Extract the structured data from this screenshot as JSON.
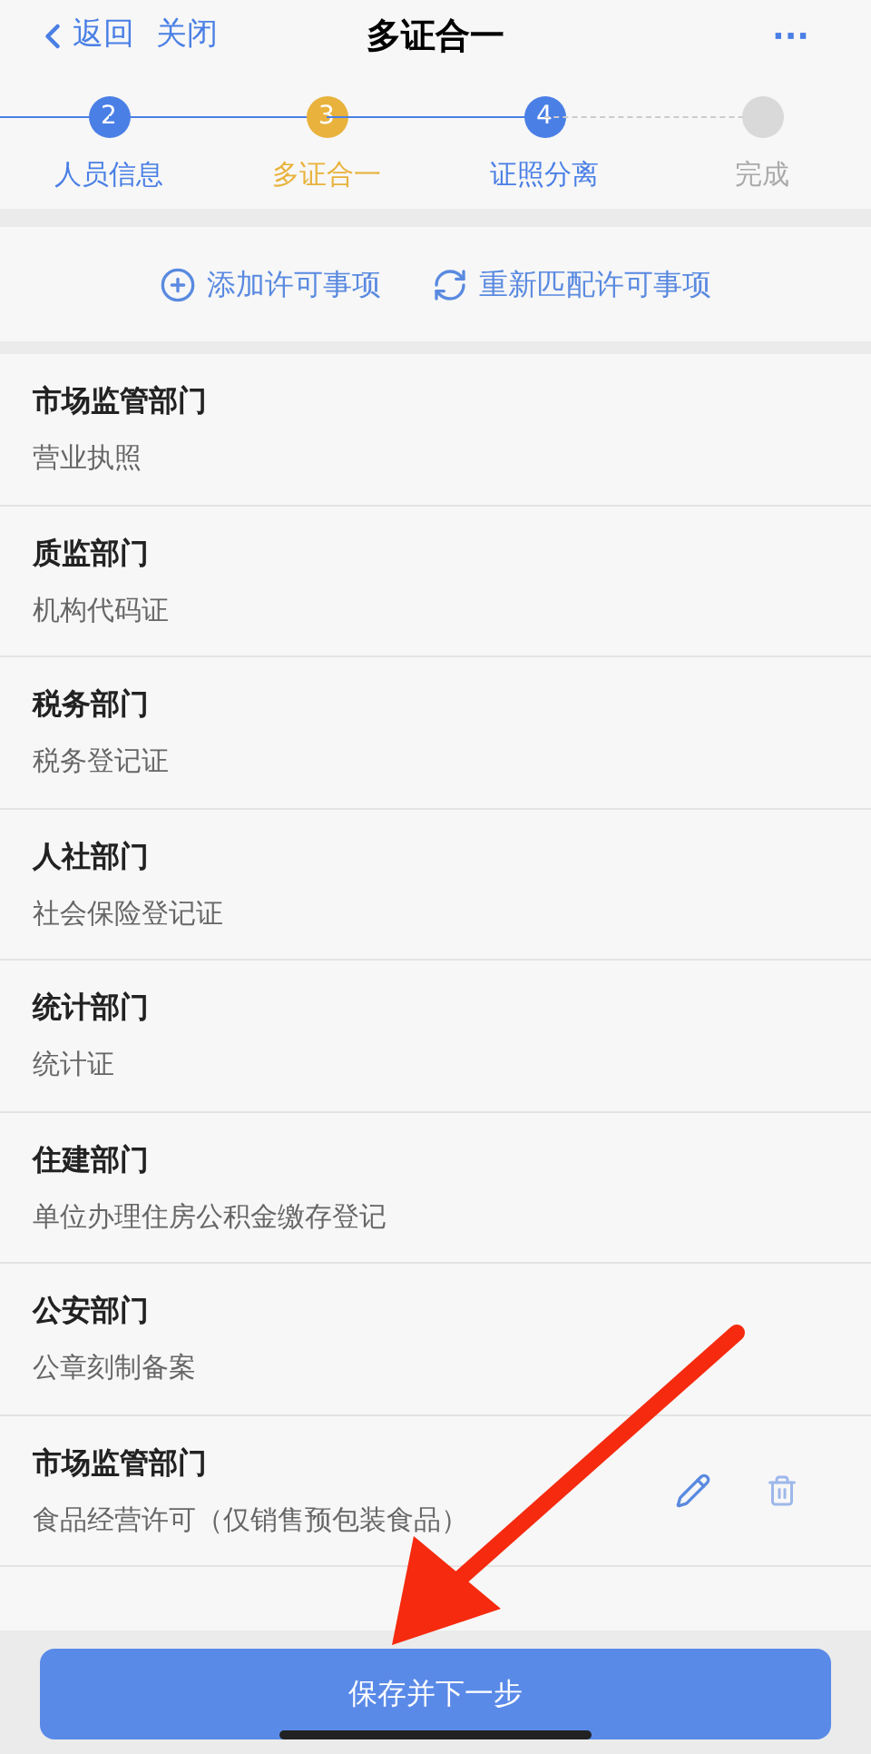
{
  "nav": {
    "back": "返回",
    "close": "关闭",
    "title": "多证合一",
    "more": "···"
  },
  "steps": [
    {
      "number": "2",
      "label": "人员信息",
      "reached": true,
      "selected": false
    },
    {
      "number": "3",
      "label": "多证合一",
      "reached": true,
      "selected": true
    },
    {
      "number": "4",
      "label": "证照分离",
      "reached": true,
      "selected": false
    },
    {
      "label": "完成",
      "reached": false,
      "selected": false
    }
  ],
  "actions": [
    {
      "kind": "add",
      "label": "添加许可事项"
    },
    {
      "kind": "refresh",
      "label": "重新匹配许可事项"
    }
  ],
  "items": [
    {
      "department": "市场监管部门",
      "license": "营业执照",
      "editable": false
    },
    {
      "department": "质监部门",
      "license": "机构代码证",
      "editable": false
    },
    {
      "department": "税务部门",
      "license": "税务登记证",
      "editable": false
    },
    {
      "department": "人社部门",
      "license": "社会保险登记证",
      "editable": false
    },
    {
      "department": "统计部门",
      "license": "统计证",
      "editable": false
    },
    {
      "department": "住建部门",
      "license": "单位办理住房公积金缴存登记",
      "editable": false
    },
    {
      "department": "公安部门",
      "license": "公章刻制备案",
      "editable": false
    },
    {
      "department": "市场监管部门",
      "license": "食品经营许可（仅销售预包装食品）",
      "editable": true
    }
  ],
  "primary_button": "保存并下一步"
}
